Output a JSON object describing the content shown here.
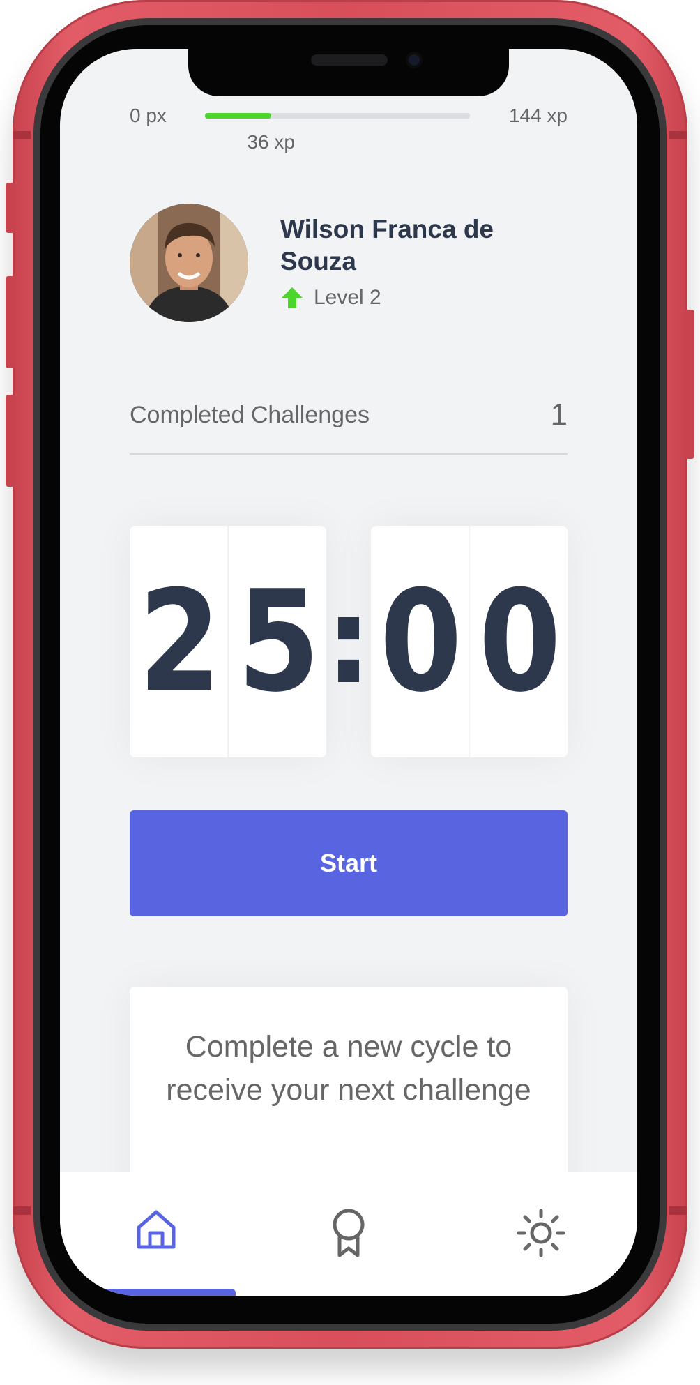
{
  "xp": {
    "min_label": "0 px",
    "max_label": "144 xp",
    "current_label": "36 xp",
    "progress_fraction": 0.25
  },
  "profile": {
    "name": "Wilson Franca de Souza",
    "level_label": "Level 2"
  },
  "stats": {
    "completed_challenges_label": "Completed Challenges",
    "completed_challenges_count": "1"
  },
  "countdown": {
    "minute_tens": "2",
    "minute_ones": "5",
    "separator": ":",
    "second_tens": "0",
    "second_ones": "0"
  },
  "actions": {
    "start_label": "Start"
  },
  "challenge_card": {
    "message": "Complete a new cycle to receive your next challenge"
  },
  "nav": {
    "items": [
      {
        "icon": "home-icon",
        "active": true
      },
      {
        "icon": "award-icon",
        "active": false
      },
      {
        "icon": "sun-icon",
        "active": false
      }
    ]
  },
  "colors": {
    "accent": "#5965e0",
    "progress": "#4cd62b",
    "text_dark": "#2e384d",
    "text_muted": "#666666",
    "frame": "#d84f5b"
  }
}
